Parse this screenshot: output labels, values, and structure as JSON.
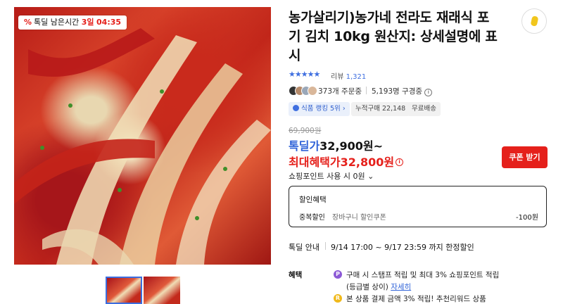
{
  "deal_badge": {
    "label": "톡딜 남은시간",
    "days": "3일",
    "time": "04:35"
  },
  "product": {
    "title": "농가살리기)농가네 전라도 재래식 포기 김치 10kg 원산지: 상세설명에 표시"
  },
  "rating": {
    "stars": "★★★★★",
    "review_label": "리뷰",
    "review_count": "1,321"
  },
  "social": {
    "orders": "373개 주문중",
    "subscribers": "5,193명 구경중"
  },
  "tags": {
    "rank": "식품 랭킹 5위",
    "cumulative": "누적구매 22,148",
    "shipping": "무료배송"
  },
  "price": {
    "list_price": "69,900원",
    "deal_label": "톡딜가",
    "deal_price": "32,900원~",
    "max_label": "최대혜택가",
    "max_price": "32,800원",
    "point_text": "쇼핑포인트 사용 시 0원"
  },
  "coupon_button": "쿠폰 받기",
  "benefit": {
    "title": "할인혜택",
    "kind": "중복할인",
    "desc": "장바구니 할인쿠폰",
    "amount": "-100원"
  },
  "deal_info": {
    "label": "톡딜 안내",
    "text": "9/14 17:00 ~ 9/17 23:59 까지 한정할인"
  },
  "perks": {
    "label": "혜택",
    "item1_line1": "구매 시 스탬프 적립 및 최대 3% 쇼핑포인트 적립",
    "item1_line2": "(등급별 상이)",
    "item1_more": "자세히",
    "item2": "본 상품 결제 금액 3% 적립! 추천리워드 상품"
  },
  "colors": {
    "accent_red": "#e5201b",
    "accent_blue": "#2f62d8"
  }
}
